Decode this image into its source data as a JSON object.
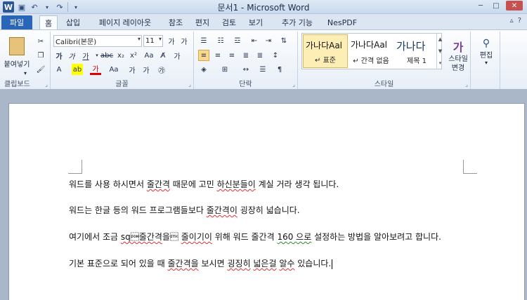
{
  "window": {
    "title": "문서1 - Microsoft Word"
  },
  "tabs": [
    "파일",
    "홈",
    "삽입",
    "페이지 레이아웃",
    "참조",
    "편지",
    "검토",
    "보기",
    "추가 기능",
    "NesPDF"
  ],
  "ribbon": {
    "clipboard": {
      "paste_label": "붙여넣기",
      "group_label": "클립보드"
    },
    "font": {
      "font_name": "Calibri(본문)",
      "font_size": "11",
      "group_label": "글꼴"
    },
    "paragraph": {
      "group_label": "단락"
    },
    "styles": {
      "group_label": "스타일",
      "items": [
        {
          "sample": "가나다Aal",
          "name": "↵ 표준"
        },
        {
          "sample": "가나다Aal",
          "name": "↵ 간격 없음"
        },
        {
          "sample": "가나다",
          "name": "제목 1"
        }
      ],
      "change_label": "스타일\n변경"
    },
    "editing": {
      "label": "편집"
    }
  },
  "document": {
    "paragraphs": [
      "워드를 사용 하시면서 줄간격 때문에 고민 하신분들이 계실 거라 생각 됩니다.",
      "워드는 한글 등의 워드 프로그램들보다 줄간격이 굉장히 넓습니다.",
      "여기에서 조금 줄간격을 줄이기이 위해 워드 줄간격 160 으로 설정하는 방법을 알아보려고 합니다.",
      "기본 표준으로 되어 있을 때 줄간격을 보시면 굉징히 넓은걸 알수 있습니다."
    ]
  }
}
